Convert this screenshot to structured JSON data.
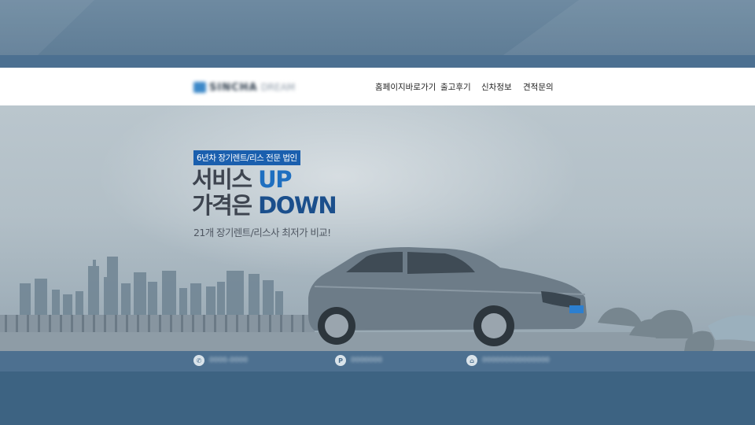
{
  "header": {
    "logo_text": "SINCHA",
    "logo_sub": "DREAM",
    "nav": [
      {
        "label": "홈페이지바로가기"
      },
      {
        "label": "출고후기"
      },
      {
        "label": "신차정보"
      },
      {
        "label": "견적문의"
      }
    ]
  },
  "hero": {
    "badge": "6년차 장기렌트/리스 전문 법인",
    "line1_text": "서비스 ",
    "line1_accent": "UP",
    "line2_text": "가격은 ",
    "line2_accent": "DOWN",
    "subtitle": "21개 장기렌트/리스사 최저가 비교!"
  },
  "contact_bar": {
    "items": [
      {
        "icon": "phone-icon",
        "glyph": "✆",
        "text": "0000-0000"
      },
      {
        "icon": "parking-icon",
        "glyph": "P",
        "text": "0000000"
      },
      {
        "icon": "home-icon",
        "glyph": "⌂",
        "text": "000000000000000"
      }
    ]
  },
  "colors": {
    "badge_bg": "#1a5fae",
    "accent_blue": "#1f6fc0",
    "accent_dark": "#1b4f8c",
    "bar": "#4d7090"
  }
}
